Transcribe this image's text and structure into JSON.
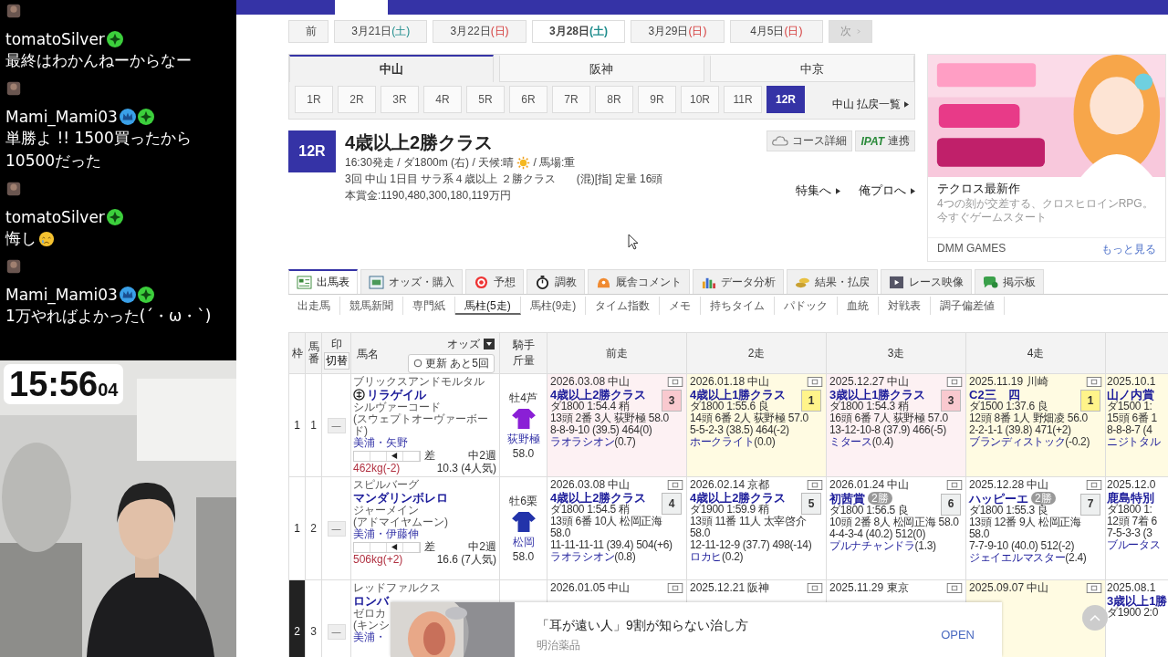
{
  "chat": [
    {
      "user": "tomatoSilver",
      "badges": [
        {
          "kind": "star"
        }
      ],
      "text": "最終はわかんねーからなー",
      "crying_emoji": false
    },
    {
      "user": "Mami_Mami03",
      "badges": [
        {
          "kind": "crown"
        },
        {
          "kind": "star"
        }
      ],
      "text": "単勝よ !! 1500買ったから10500だった",
      "crying_emoji": false
    },
    {
      "user": "tomatoSilver",
      "badges": [
        {
          "kind": "star"
        }
      ],
      "text": "悔し",
      "crying_emoji": true
    },
    {
      "user": "Mami_Mami03",
      "badges": [
        {
          "kind": "crown"
        },
        {
          "kind": "star"
        }
      ],
      "text": "1万やればよかった(´・ω・`)",
      "crying_emoji": false
    }
  ],
  "clock": {
    "time": "15:56",
    "seconds": "04"
  },
  "date_nav": {
    "prev": "前",
    "next": "次",
    "next_disabled": true,
    "dates": [
      {
        "label": "3月21日",
        "day": "(土)",
        "kind": "sat",
        "selected": false
      },
      {
        "label": "3月22日",
        "day": "(日)",
        "kind": "sun",
        "selected": false
      },
      {
        "label": "3月28日",
        "day": "(土)",
        "kind": "sat",
        "selected": true
      },
      {
        "label": "3月29日",
        "day": "(日)",
        "kind": "sun",
        "selected": false
      },
      {
        "label": "4月5日",
        "day": "(日)",
        "kind": "sun",
        "selected": false
      }
    ]
  },
  "venues": [
    {
      "label": "中山",
      "selected": true
    },
    {
      "label": "阪神",
      "selected": false
    },
    {
      "label": "中京",
      "selected": false
    }
  ],
  "races": [
    {
      "label": "1R",
      "selected": false
    },
    {
      "label": "2R",
      "selected": false
    },
    {
      "label": "3R",
      "selected": false
    },
    {
      "label": "4R",
      "selected": false
    },
    {
      "label": "5R",
      "selected": false
    },
    {
      "label": "6R",
      "selected": false
    },
    {
      "label": "7R",
      "selected": false
    },
    {
      "label": "8R",
      "selected": false
    },
    {
      "label": "9R",
      "selected": false
    },
    {
      "label": "10R",
      "selected": false
    },
    {
      "label": "11R",
      "selected": false
    },
    {
      "label": "12R",
      "selected": true
    }
  ],
  "payout_link": "中山 払戻一覧",
  "race": {
    "number": "12R",
    "title": "4歳以上2勝クラス",
    "info": "16:30発走 / ダ1800m (右) / 天候:晴",
    "weather": {
      "kind": "sunny"
    },
    "track": "/ 馬場:重",
    "meta": "3回 中山 1日目 サラ系４歳以上 ２勝クラス",
    "conditions": "(混)[指] 定量 16頭",
    "prize": "本賞金:1190,480,300,180,119万円",
    "buttons": [
      {
        "kind": "course",
        "label": "コース詳細"
      },
      {
        "kind": "ipat",
        "logo": "IPAT",
        "label": "連携"
      }
    ],
    "links": [
      "特集へ",
      "俺プロへ"
    ]
  },
  "ad_card": {
    "title": "テクロス最新作",
    "description": "4つの刻が交差する、クロスヒロインRPG。今すぐゲームスタート",
    "sponsor": "DMM GAMES",
    "more": "もっと見る"
  },
  "tabs": [
    {
      "kind": "table",
      "label": "出馬表",
      "selected": true
    },
    {
      "kind": "odds",
      "label": "オッズ・購入",
      "selected": false
    },
    {
      "kind": "target",
      "label": "予想",
      "selected": false
    },
    {
      "kind": "stopwatch",
      "label": "調教",
      "selected": false
    },
    {
      "kind": "comment",
      "label": "厩舎コメント",
      "selected": false
    },
    {
      "kind": "chart",
      "label": "データ分析",
      "selected": false
    },
    {
      "kind": "coins",
      "label": "結果・払戻",
      "selected": false
    },
    {
      "kind": "video",
      "label": "レース映像",
      "selected": false
    },
    {
      "kind": "board",
      "label": "掲示板",
      "selected": false
    }
  ],
  "sub_tabs": [
    {
      "label": "出走馬",
      "selected": false
    },
    {
      "label": "競馬新聞",
      "selected": false
    },
    {
      "label": "専門紙",
      "selected": false
    },
    {
      "label": "馬柱(5走)",
      "selected": true
    },
    {
      "label": "馬柱(9走)",
      "selected": false
    },
    {
      "label": "タイム指数",
      "selected": false
    },
    {
      "label": "メモ",
      "selected": false
    },
    {
      "label": "持ちタイム",
      "selected": false
    },
    {
      "label": "パドック",
      "selected": false
    },
    {
      "label": "血統",
      "selected": false
    },
    {
      "label": "対戦表",
      "selected": false
    },
    {
      "label": "調子偏差値",
      "selected": false
    }
  ],
  "table": {
    "columns": {
      "frame": "枠",
      "number": "馬番",
      "mark": "印",
      "mark_button": "切替",
      "horse": "馬名",
      "odds": "オッズ",
      "refresh": "更新 あと5回",
      "jockey": "騎手",
      "weight": "斤量",
      "past": [
        "前走",
        "2走",
        "3走",
        "4走"
      ]
    },
    "rows": [
      {
        "frame": {
          "text": "1",
          "color": "#ffffff"
        },
        "number": "1",
        "mark": "—",
        "sire": "ブリックスアンドモルタル",
        "name": "リラゲイル",
        "name_icon": true,
        "dam": "シルヴァーコード",
        "damsire": "(スウェプトオーヴァーボード)",
        "trainer": "美浦・矢野",
        "style_cells": [
          {
            "selected": false
          },
          {
            "selected": false
          },
          {
            "selected": true
          },
          {
            "selected": false
          }
        ],
        "style": "差",
        "interval": "中2週",
        "body_weight": "462kg(-2)",
        "odds": "10.3 (4人気)",
        "sex_age": "牡4芦",
        "silks": {
          "color": "#8a1fd6"
        },
        "jockey": "荻野極",
        "load": "58.0",
        "past": [
          {
            "date": "2026.03.08 中山",
            "race": "4歳以上2勝クラス",
            "rank": "3",
            "kind": "place",
            "time": "ダ1800 1:54.4 稍",
            "detail": "13頭 2番 3人 荻野極 58.0",
            "passing": "8-8-9-10 (39.5) 464(0)",
            "winner": "ラオラシオン",
            "margin": "(0.7)"
          },
          {
            "date": "2026.01.18 中山",
            "race": "4歳以上1勝クラス",
            "rank": "1",
            "kind": "win",
            "time": "ダ1800 1:55.6 良",
            "detail": "14頭 6番 2人 荻野極 57.0",
            "passing": "5-5-2-3 (38.5) 464(-2)",
            "winner": "ホークライト",
            "margin": "(0.0)"
          },
          {
            "date": "2025.12.27 中山",
            "race": "3歳以上1勝クラス",
            "rank": "3",
            "kind": "place",
            "time": "ダ1800 1:54.3 稍",
            "detail": "16頭 6番 7人 荻野極 57.0",
            "passing": "13-12-10-8 (37.9) 466(-5)",
            "winner": "ミタース",
            "margin": "(0.4)"
          },
          {
            "date": "2025.11.19 川崎",
            "race": "C2三　四",
            "rank": "1",
            "kind": "win",
            "time": "ダ1500 1:37.6 良",
            "detail": "12頭 8番 1人 野畑凌 56.0",
            "passing": "2-2-1-1 (39.8) 471(+2)",
            "winner": "ブランディストック",
            "margin": "(-0.2)"
          },
          {
            "date": "2025.10.1",
            "race": "山ノ内賞",
            "kind": "win",
            "time": "ダ1500 1:",
            "detail": "15頭 6番 1",
            "passing": "8-8-8-7 (4",
            "winner": "ニジトタル"
          }
        ]
      },
      {
        "frame": {
          "text": "1",
          "color": "#ffffff"
        },
        "number": "2",
        "mark": "—",
        "sire": "スピルバーグ",
        "name": "マンダリンボレロ",
        "name_icon": false,
        "dam": "ジャーメイン",
        "damsire": "(アドマイヤムーン)",
        "trainer": "美浦・伊藤伸",
        "style_cells": [
          {
            "selected": false
          },
          {
            "selected": false
          },
          {
            "selected": true
          },
          {
            "selected": false
          }
        ],
        "style": "差",
        "interval": "中2週",
        "body_weight": "506kg(+2)",
        "odds": "16.6 (7人気)",
        "sex_age": "牡6栗",
        "silks": {
          "color": "#2233aa"
        },
        "jockey": "松岡",
        "load": "58.0",
        "past": [
          {
            "date": "2026.03.08 中山",
            "race": "4歳以上2勝クラス",
            "rank": "4",
            "kind": "none",
            "time": "ダ1800 1:54.5 稍",
            "detail": "13頭 6番 10人 松岡正海 58.0",
            "passing": "11-11-11-11 (39.4) 504(+6)",
            "winner": "ラオラシオン",
            "margin": "(0.8)"
          },
          {
            "date": "2026.02.14 京都",
            "race": "4歳以上2勝クラス",
            "rank": "5",
            "kind": "none",
            "time": "ダ1900 1:59.9 稍",
            "detail": "13頭 11番 11人 太宰啓介 58.0",
            "passing": "12-11-12-9 (37.7) 498(-14)",
            "winner": "ロカヒ",
            "margin": "(0.2)"
          },
          {
            "date": "2026.01.24 中山",
            "race": "初茜賞",
            "grade": "2勝",
            "rank": "6",
            "kind": "none",
            "time": "ダ1800 1:56.5 良",
            "detail": "10頭 2番 8人 松岡正海 58.0",
            "passing": "4-4-3-4 (40.2) 512(0)",
            "winner": "プルナチャンドラ",
            "margin": "(1.3)"
          },
          {
            "date": "2025.12.28 中山",
            "race": "ハッピーエ",
            "grade": "2勝",
            "rank": "7",
            "kind": "none",
            "time": "ダ1800 1:55.3 良",
            "detail": "13頭 12番 9人 松岡正海 58.0",
            "passing": "7-7-9-10 (40.0) 512(-2)",
            "winner": "ジェイエルマスター",
            "margin": "(2.4)"
          },
          {
            "date": "2025.12.0",
            "race": "鹿島特別",
            "kind": "none",
            "time": "ダ1800 1:",
            "detail": "12頭 7着 6",
            "passing": "7-5-3-3 (3",
            "winner": "ブルータス"
          }
        ]
      },
      {
        "frame": {
          "text": "2",
          "color": "#222222"
        },
        "number": "3",
        "mark": "—",
        "sire": "レッドファルクス",
        "name": "ロンバ",
        "name_icon": false,
        "dam": "ゼロカ",
        "damsire": "(キンシ",
        "trainer": "美浦・",
        "past": [
          {
            "date": "2026.01.05 中山",
            "kind": "none"
          },
          {
            "date": "2025.12.21 阪神",
            "kind": "none"
          },
          {
            "date": "2025.11.29 東京",
            "kind": "none"
          },
          {
            "date": "2025.09.07 中山",
            "kind": "win"
          },
          {
            "date": "2025.08.1",
            "race": "3歳以上1勝",
            "time": "ダ1900 2:0",
            "kind": "none"
          }
        ]
      }
    ]
  },
  "bottom_ad": {
    "headline": "「耳が遠い人」9割が知らない治し方",
    "advertiser": "明治薬品",
    "action": "OPEN"
  }
}
